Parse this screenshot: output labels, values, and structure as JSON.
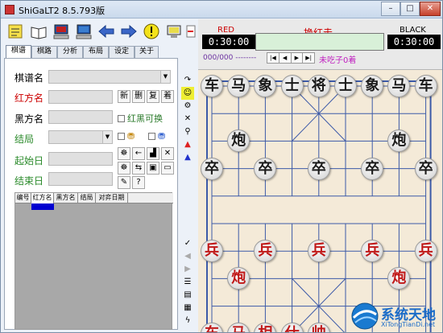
{
  "window": {
    "title": "ShiGaLT2 8.5.793版",
    "min": "–",
    "max": "□",
    "close": "✕"
  },
  "toolbar": {
    "buttons": [
      "new-icon",
      "book-icon",
      "computer-icon",
      "computer-icon",
      "back-arrow-icon",
      "forward-arrow-icon",
      "hint-icon",
      "monitor-icon",
      "exit-icon"
    ]
  },
  "tabs": [
    {
      "label": "棋谱"
    },
    {
      "label": "棋路"
    },
    {
      "label": "分析"
    },
    {
      "label": "布局"
    },
    {
      "label": "设定"
    },
    {
      "label": "关于"
    }
  ],
  "form": {
    "labels": {
      "name": "棋谱名",
      "red": "红方名",
      "black": "黑方名",
      "result": "结局",
      "start": "起始日",
      "end": "结束日"
    },
    "buttons": {
      "new": "新",
      "delete": "删",
      "copy": "复",
      "arrange": "着"
    },
    "swap": "红黑可换",
    "checks": [
      "☐",
      "☐"
    ]
  },
  "grid": {
    "columns": [
      "编号",
      "红方名",
      "黑方名",
      "结局",
      "对弈日期"
    ]
  },
  "header": {
    "red_label": "RED",
    "black_label": "BLACK",
    "red_time": "0:30:00",
    "black_time": "0:30:00",
    "status": "换红走",
    "moves": "000/000 --------",
    "nav": [
      "|◀",
      "◀",
      "▶",
      "▶|"
    ],
    "capture": "未吃子0着"
  },
  "board": {
    "pieces": [
      {
        "c": "车",
        "s": "black",
        "f": 0,
        "r": 0
      },
      {
        "c": "马",
        "s": "black",
        "f": 1,
        "r": 0
      },
      {
        "c": "象",
        "s": "black",
        "f": 2,
        "r": 0
      },
      {
        "c": "士",
        "s": "black",
        "f": 3,
        "r": 0
      },
      {
        "c": "将",
        "s": "black",
        "f": 4,
        "r": 0
      },
      {
        "c": "士",
        "s": "black",
        "f": 5,
        "r": 0
      },
      {
        "c": "象",
        "s": "black",
        "f": 6,
        "r": 0
      },
      {
        "c": "马",
        "s": "black",
        "f": 7,
        "r": 0
      },
      {
        "c": "车",
        "s": "black",
        "f": 8,
        "r": 0
      },
      {
        "c": "炮",
        "s": "black",
        "f": 1,
        "r": 2
      },
      {
        "c": "炮",
        "s": "black",
        "f": 7,
        "r": 2
      },
      {
        "c": "卒",
        "s": "black",
        "f": 0,
        "r": 3
      },
      {
        "c": "卒",
        "s": "black",
        "f": 2,
        "r": 3
      },
      {
        "c": "卒",
        "s": "black",
        "f": 4,
        "r": 3
      },
      {
        "c": "卒",
        "s": "black",
        "f": 6,
        "r": 3
      },
      {
        "c": "卒",
        "s": "black",
        "f": 8,
        "r": 3
      },
      {
        "c": "兵",
        "s": "red",
        "f": 0,
        "r": 6
      },
      {
        "c": "兵",
        "s": "red",
        "f": 2,
        "r": 6
      },
      {
        "c": "兵",
        "s": "red",
        "f": 4,
        "r": 6
      },
      {
        "c": "兵",
        "s": "red",
        "f": 6,
        "r": 6
      },
      {
        "c": "兵",
        "s": "red",
        "f": 8,
        "r": 6
      },
      {
        "c": "炮",
        "s": "red",
        "f": 1,
        "r": 7
      },
      {
        "c": "炮",
        "s": "red",
        "f": 7,
        "r": 7
      },
      {
        "c": "车",
        "s": "red",
        "f": 0,
        "r": 9
      },
      {
        "c": "马",
        "s": "red",
        "f": 1,
        "r": 9
      },
      {
        "c": "相",
        "s": "red",
        "f": 2,
        "r": 9
      },
      {
        "c": "仕",
        "s": "red",
        "f": 3,
        "r": 9
      },
      {
        "c": "帅",
        "s": "red",
        "f": 4,
        "r": 9
      }
    ]
  },
  "watermark": {
    "cn": "系统天地",
    "url": "XiTongTianDi.net"
  }
}
